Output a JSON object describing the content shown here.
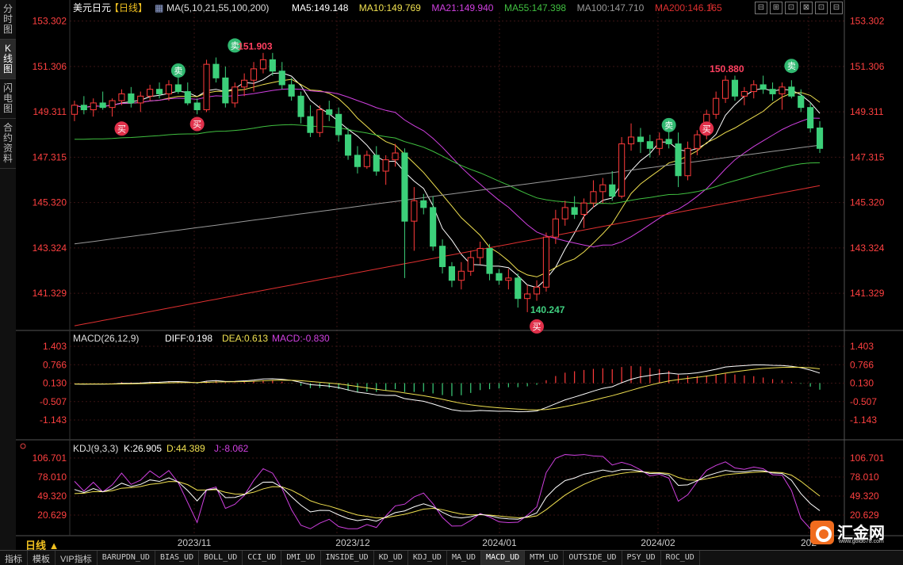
{
  "left_tabs": [
    "分时图",
    "K线图",
    "闪电图",
    "合约资料"
  ],
  "active_left_tab": 1,
  "legend": {
    "symbol": "美元日元",
    "period": "【日线】",
    "ma_header": "MA(5,10,21,55,100,200)",
    "items": [
      {
        "text": "MA5:149.148",
        "color": "#ffffff"
      },
      {
        "text": "MA10:149.769",
        "color": "#f0e050"
      },
      {
        "text": "MA21:149.940",
        "color": "#d040e0"
      },
      {
        "text": "MA55:147.398",
        "color": "#40c040"
      },
      {
        "text": "MA100:147.710",
        "color": "#999999"
      },
      {
        "text": "MA200:146.165",
        "color": "#e03030"
      }
    ]
  },
  "top_icons": [
    "⊟",
    "⊞",
    "⊡",
    "⊠",
    "⊡",
    "⊟"
  ],
  "price_axis": [
    "153.302",
    "151.306",
    "149.311",
    "147.315",
    "145.320",
    "143.324",
    "141.329"
  ],
  "macd": {
    "title": "MACD(26,12,9)",
    "diff": "DIFF:0.198",
    "dea": "DEA:0.613",
    "macd": "MACD:-0.830",
    "axis": [
      "1.403",
      "0.766",
      "0.130",
      "-0.507",
      "-1.143"
    ]
  },
  "kdj": {
    "title": "KDJ(9,3,3)",
    "k": "K:26.905",
    "d": "D:44.389",
    "j": "J:-8.062",
    "axis": [
      "106.701",
      "78.010",
      "49.320",
      "20.629"
    ]
  },
  "x_axis": [
    "2023/11",
    "2023/12",
    "2024/01",
    "2024/02",
    "202"
  ],
  "annotations": [
    {
      "text": "151.903",
      "color": "#ff4060"
    },
    {
      "text": "150.880",
      "color": "#ff4060"
    },
    {
      "text": "140.247",
      "color": "#40d080"
    }
  ],
  "signal_buy": "买",
  "signal_sell": "卖",
  "timeframe_label": "日线 ▲",
  "bottom_tabs": [
    "指标",
    "模板",
    "VIP指标",
    "BARUPDN_UD",
    "BIAS_UD",
    "BOLL_UD",
    "CCI_UD",
    "DMI_UD",
    "INSIDE_UD",
    "KD_UD",
    "KDJ_UD",
    "MA_UD",
    "MACD_UD",
    "MTM_UD",
    "OUTSIDE_UD",
    "PSY_UD",
    "ROC_UD"
  ],
  "active_bottom_tab": "MACD_UD",
  "logo": {
    "text": "汇金网",
    "url": "www.gold678.com"
  },
  "colors": {
    "up": "#ff3b3b",
    "down": "#3cd07a",
    "grid": "#3a1a1a",
    "axis_text": "#ff4040"
  },
  "chart_data": {
    "type": "candlestick",
    "period": "daily",
    "ylim": [
      139.8,
      153.6
    ],
    "candles": [
      [
        149.2,
        149.8,
        148.9,
        149.6
      ],
      [
        149.6,
        150.0,
        149.2,
        149.4
      ],
      [
        149.4,
        149.9,
        149.1,
        149.7
      ],
      [
        149.7,
        150.2,
        149.4,
        149.5
      ],
      [
        149.5,
        149.9,
        149.1,
        149.8
      ],
      [
        149.8,
        150.3,
        149.6,
        150.1
      ],
      [
        150.1,
        150.4,
        149.5,
        149.7
      ],
      [
        149.7,
        150.2,
        149.3,
        150.0
      ],
      [
        150.0,
        150.5,
        149.8,
        150.3
      ],
      [
        150.3,
        150.6,
        149.9,
        150.1
      ],
      [
        150.1,
        150.7,
        149.8,
        150.5
      ],
      [
        150.5,
        151.0,
        150.1,
        150.2
      ],
      [
        150.2,
        150.6,
        149.6,
        149.7
      ],
      [
        149.7,
        149.9,
        149.2,
        149.4
      ],
      [
        149.4,
        151.6,
        149.3,
        151.4
      ],
      [
        151.4,
        151.7,
        150.6,
        150.8
      ],
      [
        150.8,
        151.3,
        149.5,
        149.7
      ],
      [
        149.7,
        150.6,
        149.5,
        150.4
      ],
      [
        150.4,
        151.0,
        150.0,
        150.7
      ],
      [
        150.7,
        151.5,
        150.2,
        151.2
      ],
      [
        151.2,
        151.9,
        151.0,
        151.6
      ],
      [
        151.6,
        151.9,
        150.9,
        151.1
      ],
      [
        151.1,
        151.5,
        150.3,
        150.5
      ],
      [
        150.5,
        150.8,
        149.8,
        150.0
      ],
      [
        150.0,
        150.2,
        148.8,
        149.1
      ],
      [
        149.1,
        149.6,
        148.2,
        148.4
      ],
      [
        148.4,
        149.6,
        148.2,
        149.4
      ],
      [
        149.4,
        149.8,
        148.9,
        149.2
      ],
      [
        149.2,
        149.5,
        148.0,
        148.3
      ],
      [
        148.3,
        148.6,
        147.2,
        147.4
      ],
      [
        147.4,
        147.8,
        146.6,
        146.9
      ],
      [
        146.9,
        147.6,
        146.8,
        147.4
      ],
      [
        147.4,
        147.8,
        146.5,
        146.7
      ],
      [
        146.7,
        147.4,
        146.1,
        147.2
      ],
      [
        147.2,
        147.9,
        146.9,
        147.5
      ],
      [
        147.5,
        147.7,
        142.0,
        144.5
      ],
      [
        144.5,
        146.0,
        143.2,
        145.4
      ],
      [
        145.4,
        145.7,
        144.8,
        145.1
      ],
      [
        145.1,
        145.6,
        143.2,
        143.4
      ],
      [
        143.4,
        143.7,
        142.2,
        142.5
      ],
      [
        142.5,
        142.7,
        141.6,
        141.9
      ],
      [
        141.9,
        142.7,
        141.5,
        142.3
      ],
      [
        142.3,
        143.2,
        142.1,
        142.9
      ],
      [
        142.9,
        143.6,
        142.6,
        143.3
      ],
      [
        143.3,
        143.5,
        141.9,
        142.2
      ],
      [
        142.2,
        142.4,
        141.7,
        141.9
      ],
      [
        141.9,
        142.4,
        141.5,
        142.0
      ],
      [
        142.0,
        142.2,
        140.7,
        141.1
      ],
      [
        141.1,
        141.7,
        140.5,
        141.3
      ],
      [
        141.3,
        141.9,
        141.0,
        141.6
      ],
      [
        141.6,
        144.0,
        141.4,
        143.8
      ],
      [
        143.8,
        145.0,
        143.5,
        144.6
      ],
      [
        144.6,
        145.4,
        144.3,
        145.1
      ],
      [
        145.1,
        145.6,
        144.6,
        144.8
      ],
      [
        144.8,
        145.5,
        144.2,
        145.3
      ],
      [
        145.3,
        146.3,
        145.1,
        145.8
      ],
      [
        145.8,
        146.4,
        145.3,
        146.1
      ],
      [
        146.1,
        146.7,
        145.4,
        145.6
      ],
      [
        145.6,
        148.2,
        145.5,
        147.9
      ],
      [
        147.9,
        148.8,
        147.6,
        148.2
      ],
      [
        148.2,
        148.6,
        147.5,
        148.0
      ],
      [
        148.0,
        148.3,
        147.3,
        147.7
      ],
      [
        147.7,
        148.4,
        147.4,
        148.1
      ],
      [
        148.1,
        148.5,
        147.7,
        147.9
      ],
      [
        147.9,
        148.4,
        146.0,
        146.5
      ],
      [
        146.5,
        148.0,
        146.3,
        147.7
      ],
      [
        147.7,
        148.5,
        147.4,
        148.3
      ],
      [
        148.3,
        149.4,
        148.1,
        149.2
      ],
      [
        149.2,
        150.2,
        149.0,
        149.9
      ],
      [
        149.9,
        150.9,
        149.7,
        150.7
      ],
      [
        150.7,
        150.9,
        149.8,
        150.0
      ],
      [
        150.0,
        150.4,
        149.6,
        150.2
      ],
      [
        150.2,
        150.7,
        149.9,
        150.5
      ],
      [
        150.5,
        150.9,
        150.1,
        150.3
      ],
      [
        150.3,
        150.6,
        149.8,
        150.1
      ],
      [
        150.1,
        150.6,
        149.4,
        150.4
      ],
      [
        150.4,
        150.7,
        149.9,
        150.0
      ],
      [
        150.0,
        150.3,
        149.3,
        149.5
      ],
      [
        149.5,
        149.7,
        148.4,
        148.6
      ],
      [
        148.6,
        148.9,
        147.5,
        147.7
      ]
    ],
    "macd_axis_range": [
      -1.4,
      1.5
    ],
    "kdj_axis_range": [
      0,
      112
    ]
  }
}
